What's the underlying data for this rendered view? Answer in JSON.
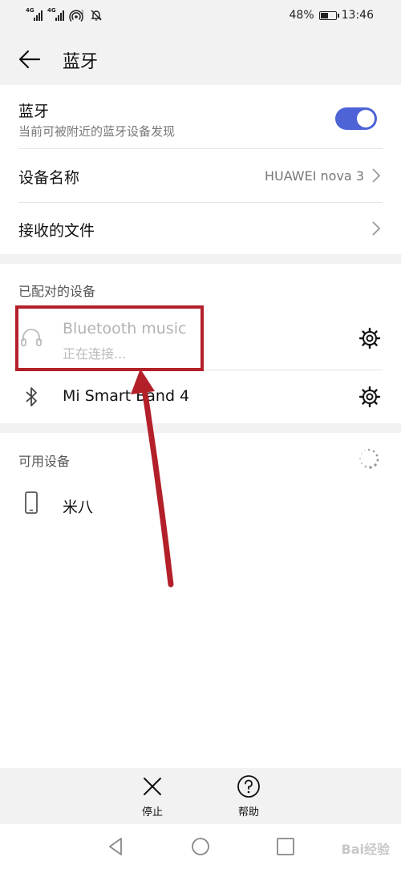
{
  "status_bar": {
    "signal1_label": "4G",
    "signal2_label": "4G",
    "hotspot_badge": "1",
    "battery": "48%",
    "time": "13:46"
  },
  "header": {
    "title": "蓝牙"
  },
  "bluetooth": {
    "title": "蓝牙",
    "subtitle": "当前可被附近的蓝牙设备发现",
    "enabled": true
  },
  "device_name": {
    "label": "设备名称",
    "value": "HUAWEI nova 3"
  },
  "received_files": {
    "label": "接收的文件"
  },
  "paired": {
    "label": "已配对的设备",
    "devices": [
      {
        "name": "Bluetooth music",
        "status": "正在连接...",
        "icon": "headphones-icon"
      },
      {
        "name": "Mi Smart Band 4",
        "status": "",
        "icon": "bluetooth-icon"
      }
    ]
  },
  "available": {
    "label": "可用设备",
    "devices": [
      {
        "name": "米八",
        "icon": "phone-icon"
      }
    ]
  },
  "actions": {
    "stop_label": "停止",
    "help_label": "帮助"
  },
  "watermark": "Bai经验",
  "colors": {
    "accent": "#4d63d6",
    "annotation": "#b3202a"
  }
}
